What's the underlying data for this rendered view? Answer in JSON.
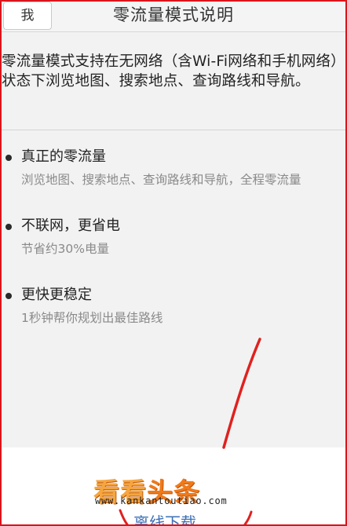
{
  "header": {
    "back_label": "我",
    "title": "零流量模式说明"
  },
  "intro_text": "零流量模式支持在无网络（含Wi-Fi网络和手机网络）状态下浏览地图、搜索地点、查询路线和导航。",
  "features": [
    {
      "title": "真正的零流量",
      "description": "浏览地图、搜索地点、查询路线和导航，全程零流量"
    },
    {
      "title": "不联网，更省电",
      "description": "节省约30%电量"
    },
    {
      "title": "更快更稳定",
      "description": "1秒钟帮你规划出最佳路线"
    }
  ],
  "footer": {
    "partial_button_label": "离线下载"
  },
  "watermark": {
    "logo_text_1": "看看",
    "logo_text_2": "头条",
    "url": "www.kankantoutiao.com"
  },
  "colors": {
    "frame_border": "#d9161c",
    "annotation_stroke": "#e0211f",
    "logo_orange": "#f07a1a",
    "link_blue": "#3b6fb6"
  }
}
